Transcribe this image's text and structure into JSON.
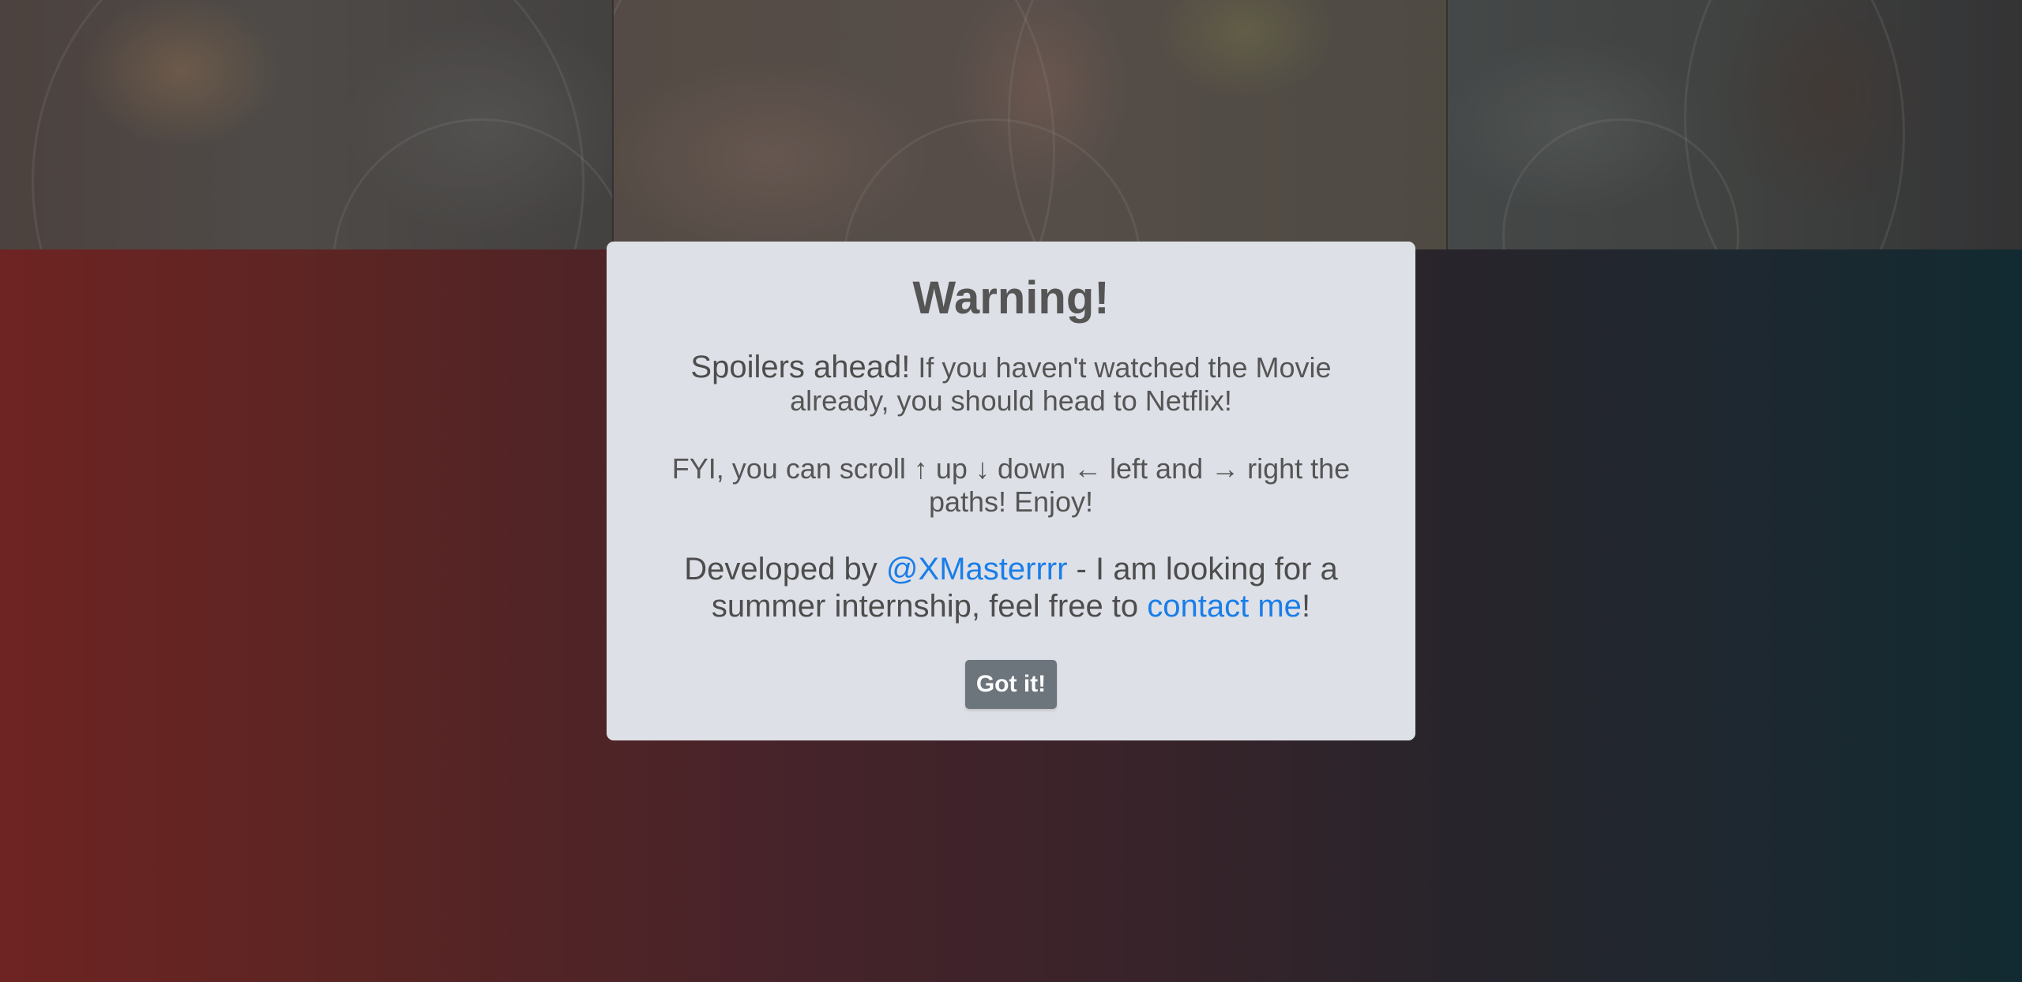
{
  "modal": {
    "title": "Warning!",
    "p1_lead": "Spoilers ahead!",
    "p1_rest": " If you haven't watched the Movie already, you should head to Netflix!",
    "p2_pre": "FYI, you can scroll ",
    "p2_up_arrow": "↑",
    "p2_up": " up ",
    "p2_down_arrow": "↓",
    "p2_down": " down ",
    "p2_left_arrow": "←",
    "p2_left": " left and ",
    "p2_right_arrow": "→",
    "p2_right": " right the paths! Enjoy!",
    "p3_pre": "Developed by ",
    "p3_handle": "@XMasterrrr",
    "p3_mid": " - I am looking for a summer internship, feel free to ",
    "p3_contact": "contact me",
    "p3_post": "!",
    "button_label": "Got it!"
  },
  "colors": {
    "modal_bg": "#dee0e7",
    "text": "#555555",
    "link": "#1a7ee8",
    "button_bg": "#6c747c",
    "bg_left": "#6e2422",
    "bg_right": "#122a31"
  }
}
